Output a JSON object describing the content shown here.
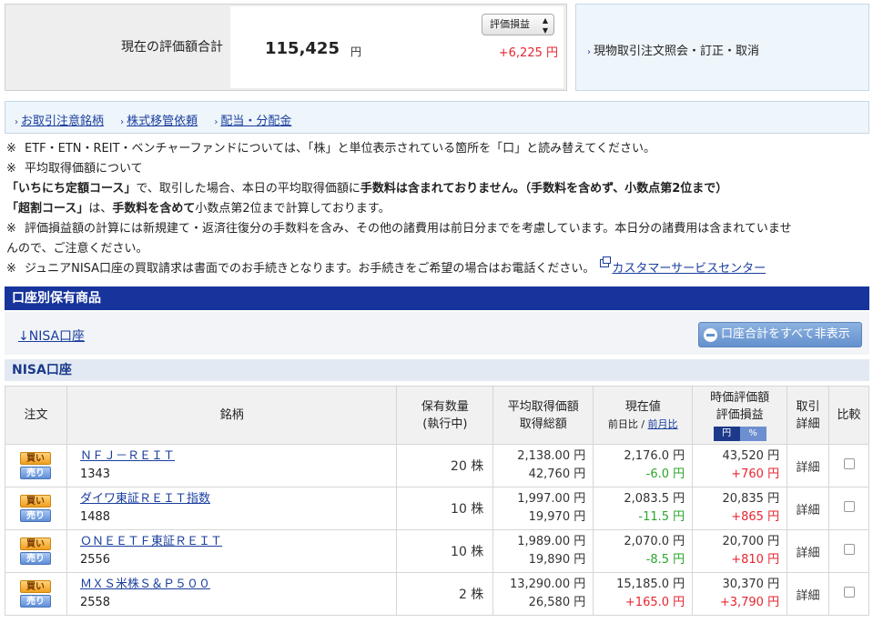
{
  "summary": {
    "label": "現在の評価額合計",
    "total": "115,425",
    "unit": "円",
    "select_value": "評価損益",
    "profit": "+6,225 円"
  },
  "side_link": "現物取引注文照会・訂正・取消",
  "links": [
    "お取引注意銘柄",
    "株式移管依頼",
    "配当・分配金"
  ],
  "notes": {
    "mark": "※",
    "n1": "ETF・ETN・REIT・ベンチャーファンドについては、「株」と単位表示されている箇所を「口」と読み替えてください。",
    "n2": "平均取得価額について",
    "n2a_bold1": "「いちにち定額コース」",
    "n2a_text1": "で、取引した場合、本日の平均取得価額に",
    "n2a_bold2": "手数料は含まれておりません。（手数料を含めず、小数点第2位まで）",
    "n2b_bold1": "「超割コース」",
    "n2b_text1": "は、",
    "n2b_bold2": "手数料を含めて",
    "n2b_text2": "小数点第2位まで計算しております。",
    "n3": "評価損益額の計算には新規建て・返済往復分の手数料を含み、その他の諸費用は前日分までを考慮しています。本日分の諸費用は含まれていませ",
    "n3b": "んので、ご注意ください。",
    "n4": "ジュニアNISA口座の買取請求は書面でのお手続きとなります。お手続きをご希望の場合はお電話ください。",
    "n4_link": "カスタマーサービスセンター"
  },
  "section_title": "口座別保有商品",
  "nisa_link": "↓NISA口座",
  "hide_all_label": "口座合計をすべて非表示",
  "nisa_title": "NISA口座",
  "table": {
    "h_order": "注文",
    "h_name": "銘柄",
    "h_qty1": "保有数量",
    "h_qty2": "(執行中)",
    "h_avg1": "平均取得価額",
    "h_avg2": "取得総額",
    "h_cur1": "現在値",
    "h_cur2a": "前日比",
    "h_cur2sep": " / ",
    "h_cur2b": "前月比",
    "h_val1": "時価評価額",
    "h_val2": "評価損益",
    "h_toggle_a": "円",
    "h_toggle_b": "%",
    "h_detail1": "取引",
    "h_detail2": "詳細",
    "h_cmp": "比較",
    "buy": "買い",
    "sell": "売り",
    "detail": "詳細",
    "rows": [
      {
        "name": "ＮＦＪ－ＲＥＩＴ",
        "code": "1343",
        "qty": "20 株",
        "avg": "2,138.00 円",
        "total": "42,760 円",
        "price": "2,176.0 円",
        "change": "-6.0 円",
        "change_color": "green",
        "value": "43,520 円",
        "pl": "+760 円"
      },
      {
        "name": "ダイワ東証ＲＥＩＴ指数",
        "code": "1488",
        "qty": "10 株",
        "avg": "1,997.00 円",
        "total": "19,970 円",
        "price": "2,083.5 円",
        "change": "-11.5 円",
        "change_color": "green",
        "value": "20,835 円",
        "pl": "+865 円"
      },
      {
        "name": "ＯＮＥＥＴＦ東証ＲＥＩＴ",
        "code": "2556",
        "qty": "10 株",
        "avg": "1,989.00 円",
        "total": "19,890 円",
        "price": "2,070.0 円",
        "change": "-8.5 円",
        "change_color": "green",
        "value": "20,700 円",
        "pl": "+810 円"
      },
      {
        "name": "ＭＸＳ米株Ｓ＆Ｐ５００",
        "code": "2558",
        "qty": "2 株",
        "avg": "13,290.00 円",
        "total": "26,580 円",
        "price": "15,185.0 円",
        "change": "+165.0 円",
        "change_color": "red",
        "value": "30,370 円",
        "pl": "+3,790 円"
      }
    ]
  }
}
